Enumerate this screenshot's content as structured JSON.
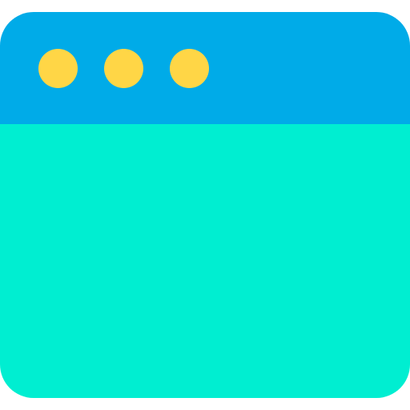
{
  "icon": "browser-window-icon",
  "colors": {
    "titlebar": "#00ABE8",
    "content": "#00EED1",
    "dots": "#FFD646"
  },
  "window_controls": [
    {
      "icon": "window-dot-icon"
    },
    {
      "icon": "window-dot-icon"
    },
    {
      "icon": "window-dot-icon"
    }
  ]
}
